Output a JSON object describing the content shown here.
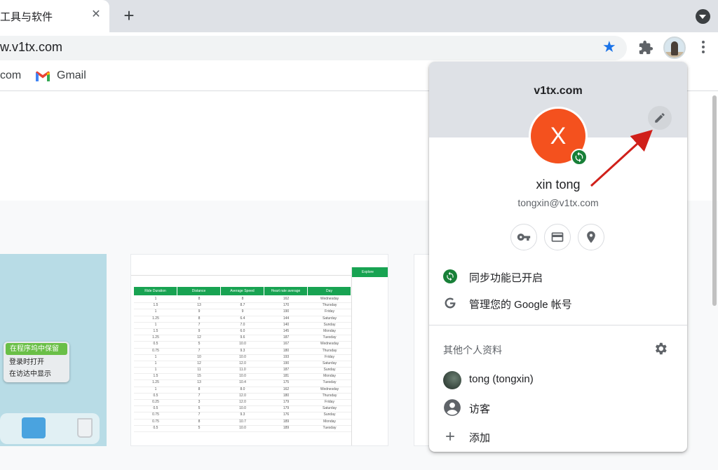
{
  "tab": {
    "title": "工具与软件",
    "close_glyph": "✕",
    "new_tab_glyph": "+"
  },
  "omnibox": {
    "url": "w.v1tx.com"
  },
  "bookmarks": {
    "items": [
      {
        "label": "com"
      },
      {
        "label": "Gmail"
      }
    ]
  },
  "background": {
    "context_menu": [
      "在程序坞中保留",
      "登录时打开",
      "在访达中显示"
    ],
    "sheet_header": [
      "Ride Duration",
      "Distance",
      "Average Speed",
      "Heart rate average",
      "Day"
    ],
    "sheet_rows": [
      [
        "1",
        "8",
        "8",
        "162",
        "Wednesday"
      ],
      [
        "1.5",
        "13",
        "8.7",
        "170",
        "Thursday"
      ],
      [
        "1",
        "9",
        "9",
        "190",
        "Friday"
      ],
      [
        "1.25",
        "8",
        "6.4",
        "144",
        "Saturday"
      ],
      [
        "1",
        "7",
        "7.0",
        "140",
        "Sunday"
      ],
      [
        "1.5",
        "9",
        "6.0",
        "145",
        "Monday"
      ],
      [
        "1.25",
        "12",
        "9.6",
        "187",
        "Tuesday"
      ],
      [
        "0.5",
        "5",
        "10.0",
        "167",
        "Wednesday"
      ],
      [
        "0.75",
        "7",
        "9.3",
        "180",
        "Thursday"
      ],
      [
        "1",
        "10",
        "10.0",
        "193",
        "Friday"
      ],
      [
        "1",
        "12",
        "12.0",
        "190",
        "Saturday"
      ],
      [
        "1",
        "11",
        "11.0",
        "187",
        "Sunday"
      ],
      [
        "1.5",
        "15",
        "10.0",
        "181",
        "Monday"
      ],
      [
        "1.25",
        "13",
        "10.4",
        "175",
        "Tuesday"
      ],
      [
        "1",
        "8",
        "8.0",
        "162",
        "Wednesday"
      ],
      [
        "0.5",
        "7",
        "12.0",
        "180",
        "Thursday"
      ],
      [
        "0.25",
        "3",
        "12.0",
        "179",
        "Friday"
      ],
      [
        "0.5",
        "5",
        "10.0",
        "179",
        "Saturday"
      ],
      [
        "0.75",
        "7",
        "9.3",
        "176",
        "Sunday"
      ],
      [
        "0.75",
        "8",
        "10.7",
        "189",
        "Monday"
      ],
      [
        "0.5",
        "5",
        "10.0",
        "189",
        "Tuesday"
      ]
    ],
    "explore_label": "Explore"
  },
  "profile_panel": {
    "account_title": "v1tx.com",
    "avatar_letter": "X",
    "name": "xin tong",
    "email": "tongxin@v1tx.com",
    "quick_actions": [
      {
        "icon": "key-icon"
      },
      {
        "icon": "card-icon"
      },
      {
        "icon": "location-icon"
      }
    ],
    "sync_label": "同步功能已开启",
    "manage_label": "管理您的 Google 帐号",
    "others_label": "其他个人资料",
    "profiles": [
      {
        "label": "tong (tongxin)"
      },
      {
        "label": "访客"
      }
    ],
    "add_label": "添加",
    "colors": {
      "avatar": "#f4511e",
      "sync": "#188038",
      "header": "#dee1e6"
    }
  }
}
